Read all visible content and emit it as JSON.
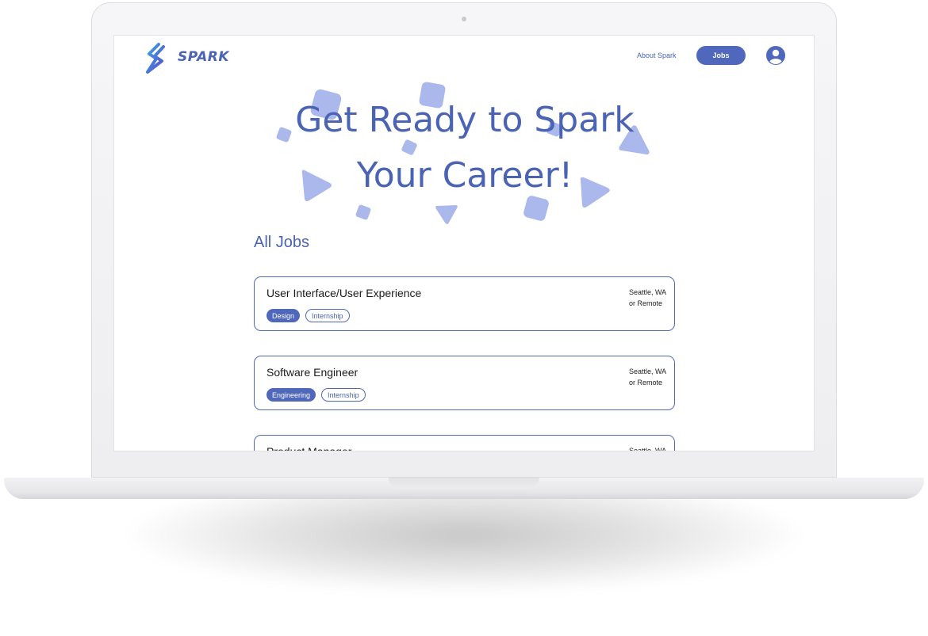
{
  "brand": {
    "name": "SPARK",
    "accent": "#4a63b4"
  },
  "nav": {
    "about_label": "About Spark",
    "jobs_label": "Jobs",
    "profile_icon": "user-circle-icon"
  },
  "hero": {
    "line1": "Get Ready to Spark",
    "line2": "Your Career!"
  },
  "section_title": "All Jobs",
  "jobs": [
    {
      "title": "User Interface/User Experience",
      "location_line1": "Seattle, WA",
      "location_line2": "or Remote",
      "tags": [
        "Design",
        "Internship"
      ]
    },
    {
      "title": "Software Engineer",
      "location_line1": "Seattle, WA",
      "location_line2": "or Remote",
      "tags": [
        "Engineering",
        "Internship"
      ]
    },
    {
      "title": "Product Manager",
      "location_line1": "Seattle, WA",
      "location_line2": "",
      "tags": []
    }
  ]
}
